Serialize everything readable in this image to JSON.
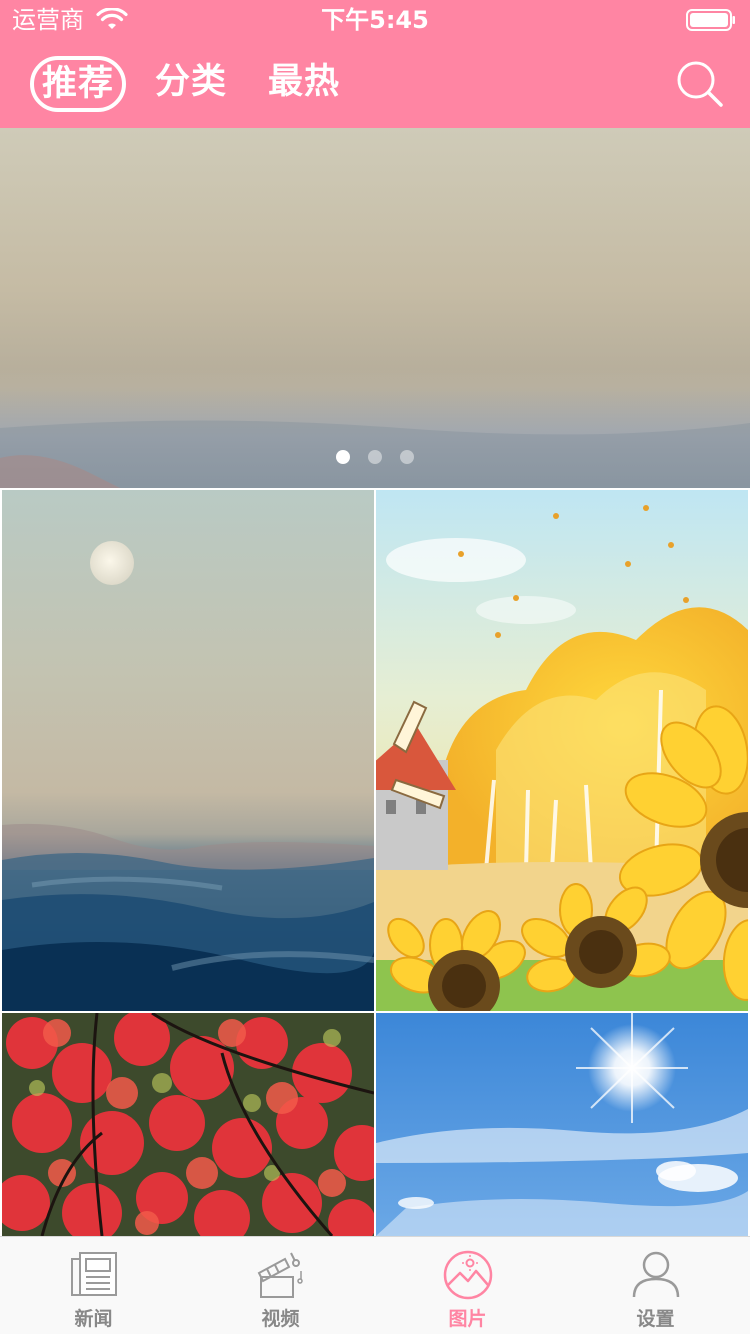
{
  "status_bar": {
    "carrier": "运营商",
    "time": "下午5:45"
  },
  "nav": {
    "tabs": [
      {
        "label": "推荐",
        "active": true
      },
      {
        "label": "分类",
        "active": false
      },
      {
        "label": "最热",
        "active": false
      }
    ],
    "search_icon": "search-icon"
  },
  "banner": {
    "page_count": 3,
    "current_page": 1
  },
  "grid": {
    "images": [
      {
        "name": "moon-over-sea-of-clouds"
      },
      {
        "name": "sunflowers-and-windmill-illustration"
      },
      {
        "name": "red-maple-leaves"
      },
      {
        "name": "sun-in-blue-sky"
      }
    ]
  },
  "tab_bar": {
    "items": [
      {
        "label": "新闻",
        "icon": "newspaper-icon",
        "active": false
      },
      {
        "label": "视频",
        "icon": "video-camera-icon",
        "active": false
      },
      {
        "label": "图片",
        "icon": "picture-icon",
        "active": true
      },
      {
        "label": "设置",
        "icon": "person-icon",
        "active": false
      }
    ]
  },
  "colors": {
    "accent": "#ff85a3",
    "tab_inactive": "#888888",
    "tab_bar_bg": "#f9f9f9"
  }
}
